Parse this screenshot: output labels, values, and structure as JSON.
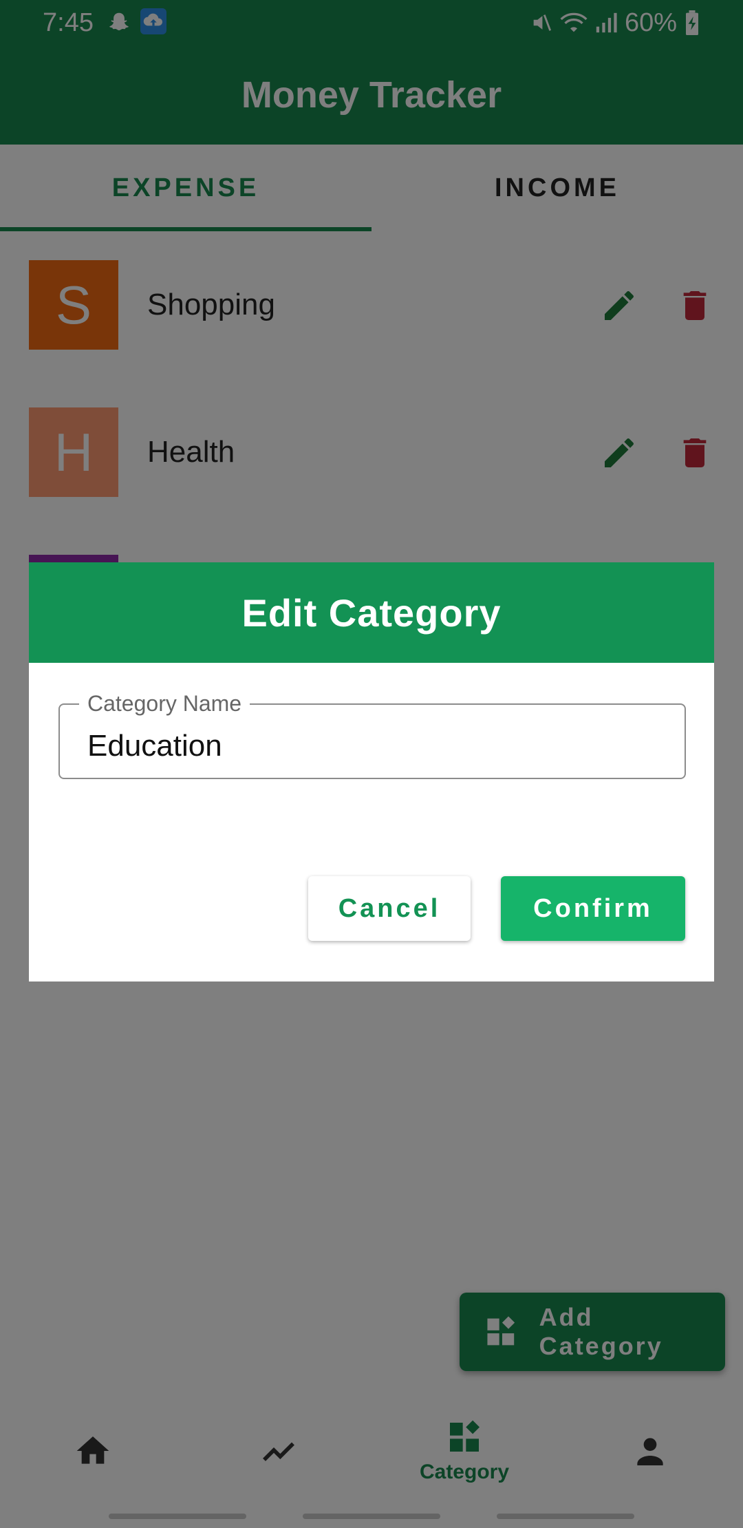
{
  "status_bar": {
    "time": "7:45",
    "battery": "60%",
    "icons": [
      "snapchat-icon",
      "cloud-upload-icon",
      "mute-icon",
      "wifi-icon",
      "signal-icon",
      "battery-charging-icon"
    ]
  },
  "app_bar": {
    "title": "Money Tracker"
  },
  "tabs": [
    {
      "label": "EXPENSE",
      "active": true
    },
    {
      "label": "INCOME",
      "active": false
    }
  ],
  "categories": [
    {
      "initial": "S",
      "name": "Shopping",
      "color": "#f26a12"
    },
    {
      "initial": "H",
      "name": "Health",
      "color": "#ff9a73"
    },
    {
      "initial": "",
      "name": "",
      "color": "#8e2aa9"
    }
  ],
  "dialog": {
    "title": "Edit Category",
    "field_label": "Category Name",
    "field_value": "Education",
    "cancel_label": "Cancel",
    "confirm_label": "Confirm"
  },
  "fab": {
    "label": "Add Category",
    "icon": "widgets-add-icon"
  },
  "bottom_nav": [
    {
      "icon": "home-icon",
      "label": "",
      "active": false
    },
    {
      "icon": "trending-icon",
      "label": "",
      "active": false
    },
    {
      "icon": "category-icon",
      "label": "Category",
      "active": true
    },
    {
      "icon": "person-icon",
      "label": "",
      "active": false
    }
  ],
  "colors": {
    "primary": "#18884f",
    "dialog_header": "#139254",
    "confirm": "#16b46a",
    "edit": "#1f7a3a",
    "delete": "#c0283a"
  }
}
